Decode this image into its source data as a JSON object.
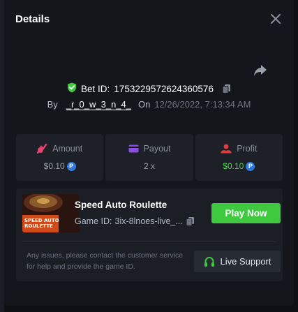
{
  "modal": {
    "title": "Details"
  },
  "bet": {
    "id_label": "Bet ID:",
    "id_value": "1753229572624360576",
    "by_label": "By",
    "username": "_r_0_w_3_n_4_",
    "on_label": "On",
    "date": "12/26/2022, 7:13:34 AM"
  },
  "stats": {
    "amount": {
      "label": "Amount",
      "value": "$0.10",
      "coin": "P"
    },
    "payout": {
      "label": "Payout",
      "value": "2 x"
    },
    "profit": {
      "label": "Profit",
      "value": "$0.10",
      "coin": "P"
    }
  },
  "game": {
    "name": "Speed Auto Roulette",
    "id_label": "Game ID:",
    "id_value": "3ix-8lnoes-live_...",
    "thumb_line1": "SPEED AUTO",
    "thumb_line2": "ROULETTE",
    "play_label": "Play Now"
  },
  "support": {
    "help_text": "Any issues, please contact the customer service for help and provide the game ID.",
    "button_label": "Live Support"
  },
  "colors": {
    "accent_green": "#3fc93f",
    "profit_green": "#4fd14a",
    "coin_blue": "#2e79e0",
    "amount_icon": "#e0456f",
    "payout_icon": "#8a4fe0",
    "profit_icon": "#e03a3a"
  }
}
